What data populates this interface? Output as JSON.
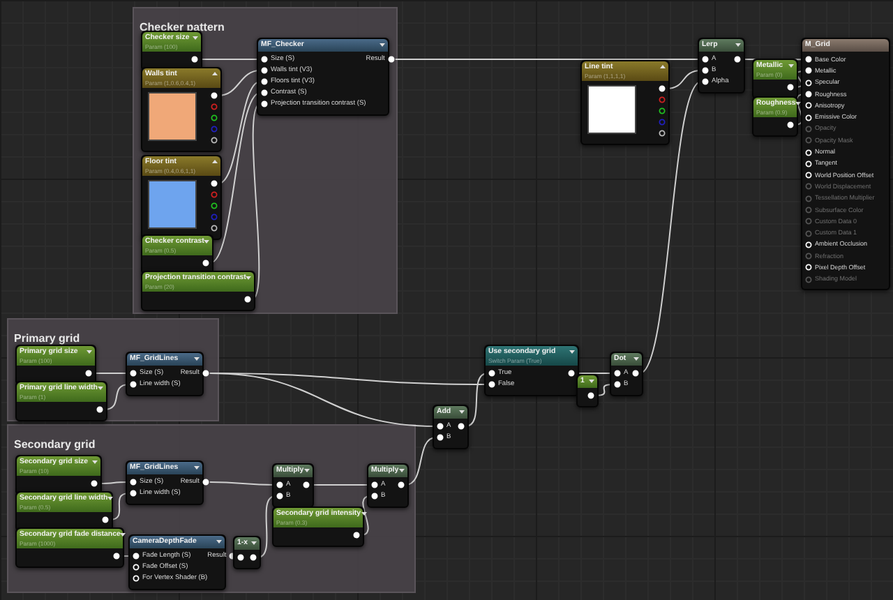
{
  "comments": [
    {
      "title": "Checker pattern"
    },
    {
      "title": "Primary grid"
    },
    {
      "title": "Secondary grid"
    }
  ],
  "nodes": [
    {
      "kind": "scalar_param",
      "title": "Checker size",
      "subtitle": "Param (100)",
      "outputs": [
        {
          "connected": true
        }
      ]
    },
    {
      "kind": "vector_param",
      "title": "Walls tint",
      "subtitle": "Param (1,0.6,0.4,1)",
      "color": "#f0a878",
      "outputs": [
        {
          "color": "#ffffff",
          "connected": true
        },
        {
          "color": "#d02020",
          "connected": false
        },
        {
          "color": "#20c020",
          "connected": false
        },
        {
          "color": "#2020c0",
          "connected": false
        },
        {
          "color": "#bbbbbb",
          "connected": false
        }
      ]
    },
    {
      "kind": "vector_param",
      "title": "Floor tint",
      "subtitle": "Param (0.4,0.6,1,1)",
      "color": "#6ea4ee",
      "outputs": [
        {
          "color": "#ffffff",
          "connected": true
        },
        {
          "color": "#d02020",
          "connected": false
        },
        {
          "color": "#20c020",
          "connected": false
        },
        {
          "color": "#2020c0",
          "connected": false
        },
        {
          "color": "#bbbbbb",
          "connected": false
        }
      ]
    },
    {
      "kind": "scalar_param",
      "title": "Checker contrast",
      "subtitle": "Param (0.5)",
      "outputs": [
        {
          "connected": true
        }
      ]
    },
    {
      "kind": "scalar_param",
      "title": "Projection transition contrast",
      "subtitle": "Param (20)",
      "outputs": [
        {
          "connected": true
        }
      ]
    },
    {
      "kind": "function",
      "title": "MF_Checker",
      "inputs": [
        {
          "label": "Size (S)",
          "connected": true
        },
        {
          "label": "Walls tint (V3)",
          "connected": true
        },
        {
          "label": "Floors tint (V3)",
          "connected": true
        },
        {
          "label": "Contrast (S)",
          "connected": true
        },
        {
          "label": "Projection transition contrast (S)",
          "connected": true
        }
      ],
      "outputs": [
        {
          "label": "Result",
          "connected": true
        }
      ]
    },
    {
      "kind": "vector_param",
      "title": "Line tint",
      "subtitle": "Param (1,1,1,1)",
      "color": "#ffffff",
      "outputs": [
        {
          "color": "#ffffff",
          "connected": true
        },
        {
          "color": "#d02020",
          "connected": false
        },
        {
          "color": "#20c020",
          "connected": false
        },
        {
          "color": "#2020c0",
          "connected": false
        },
        {
          "color": "#bbbbbb",
          "connected": false
        }
      ]
    },
    {
      "kind": "math",
      "title": "Lerp",
      "inputs": [
        {
          "label": "A",
          "connected": true
        },
        {
          "label": "B",
          "connected": true
        },
        {
          "label": "Alpha",
          "connected": true
        }
      ],
      "outputs": [
        {
          "connected": true
        }
      ]
    },
    {
      "kind": "scalar_param",
      "title": "Metallic",
      "subtitle": "Param (0)",
      "outputs": [
        {
          "connected": true
        }
      ]
    },
    {
      "kind": "scalar_param",
      "title": "Roughness",
      "subtitle": "Param (0.9)",
      "outputs": [
        {
          "connected": true
        }
      ]
    },
    {
      "kind": "result",
      "title": "M_Grid",
      "inputs": [
        {
          "label": "Base Color",
          "connected": true,
          "disabled": false
        },
        {
          "label": "Metallic",
          "connected": true,
          "disabled": false
        },
        {
          "label": "Specular",
          "connected": false,
          "disabled": false
        },
        {
          "label": "Roughness",
          "connected": true,
          "disabled": false
        },
        {
          "label": "Anisotropy",
          "connected": false,
          "disabled": false
        },
        {
          "label": "Emissive Color",
          "connected": false,
          "disabled": false
        },
        {
          "label": "Opacity",
          "connected": false,
          "disabled": true
        },
        {
          "label": "Opacity Mask",
          "connected": false,
          "disabled": true
        },
        {
          "label": "Normal",
          "connected": false,
          "disabled": false
        },
        {
          "label": "Tangent",
          "connected": false,
          "disabled": false
        },
        {
          "label": "World Position Offset",
          "connected": false,
          "disabled": false
        },
        {
          "label": "World Displacement",
          "connected": false,
          "disabled": true
        },
        {
          "label": "Tessellation Multiplier",
          "connected": false,
          "disabled": true
        },
        {
          "label": "Subsurface Color",
          "connected": false,
          "disabled": true
        },
        {
          "label": "Custom Data 0",
          "connected": false,
          "disabled": true
        },
        {
          "label": "Custom Data 1",
          "connected": false,
          "disabled": true
        },
        {
          "label": "Ambient Occlusion",
          "connected": false,
          "disabled": false
        },
        {
          "label": "Refraction",
          "connected": false,
          "disabled": true
        },
        {
          "label": "Pixel Depth Offset",
          "connected": false,
          "disabled": false
        },
        {
          "label": "Shading Model",
          "connected": false,
          "disabled": true
        }
      ]
    },
    {
      "kind": "scalar_param",
      "title": "Primary grid size",
      "subtitle": "Param (100)",
      "outputs": [
        {
          "connected": true
        }
      ]
    },
    {
      "kind": "scalar_param",
      "title": "Primary grid line width",
      "subtitle": "Param (1)",
      "outputs": [
        {
          "connected": true
        }
      ]
    },
    {
      "kind": "function",
      "title": "MF_GridLines",
      "inputs": [
        {
          "label": "Size (S)",
          "connected": true
        },
        {
          "label": "Line width (S)",
          "connected": true
        }
      ],
      "outputs": [
        {
          "label": "Result",
          "connected": true
        }
      ]
    },
    {
      "kind": "switch",
      "title": "Use secondary grid",
      "subtitle": "Switch Param (True)",
      "inputs": [
        {
          "label": "True",
          "connected": true
        },
        {
          "label": "False",
          "connected": true
        }
      ],
      "outputs": [
        {
          "connected": true
        }
      ]
    },
    {
      "kind": "constant",
      "title": "1",
      "outputs": [
        {
          "connected": true
        }
      ]
    },
    {
      "kind": "math",
      "title": "Dot",
      "inputs": [
        {
          "label": "A",
          "connected": true
        },
        {
          "label": "B",
          "connected": true
        }
      ],
      "outputs": [
        {
          "connected": true
        }
      ]
    },
    {
      "kind": "math",
      "title": "Add",
      "inputs": [
        {
          "label": "A",
          "connected": true
        },
        {
          "label": "B",
          "connected": true
        }
      ],
      "outputs": [
        {
          "connected": true
        }
      ]
    },
    {
      "kind": "scalar_param",
      "title": "Secondary grid size",
      "subtitle": "Param (10)",
      "outputs": [
        {
          "connected": true
        }
      ]
    },
    {
      "kind": "scalar_param",
      "title": "Secondary grid line width",
      "subtitle": "Param (0.5)",
      "outputs": [
        {
          "connected": true
        }
      ]
    },
    {
      "kind": "scalar_param",
      "title": "Secondary grid fade distance",
      "subtitle": "Param (1000)",
      "outputs": [
        {
          "connected": true
        }
      ]
    },
    {
      "kind": "function",
      "title": "MF_GridLines",
      "inputs": [
        {
          "label": "Size (S)",
          "connected": true
        },
        {
          "label": "Line width (S)",
          "connected": true
        }
      ],
      "outputs": [
        {
          "label": "Result",
          "connected": true
        }
      ]
    },
    {
      "kind": "function",
      "title": "CameraDepthFade",
      "inputs": [
        {
          "label": "Fade Length (S)",
          "connected": true
        },
        {
          "label": "Fade Offset (S)",
          "connected": false
        },
        {
          "label": "For Vertex Shader (B)",
          "connected": false
        }
      ],
      "outputs": [
        {
          "label": "Result",
          "connected": true
        }
      ]
    },
    {
      "kind": "math",
      "title": "1-x",
      "inputs": [
        {
          "connected": true
        }
      ],
      "outputs": [
        {
          "connected": true
        }
      ]
    },
    {
      "kind": "math",
      "title": "Multiply",
      "inputs": [
        {
          "label": "A",
          "connected": true
        },
        {
          "label": "B",
          "connected": true
        }
      ],
      "outputs": [
        {
          "connected": true
        }
      ]
    },
    {
      "kind": "scalar_param",
      "title": "Secondary grid intensity",
      "subtitle": "Param (0.3)",
      "outputs": [
        {
          "connected": true
        }
      ]
    },
    {
      "kind": "math",
      "title": "Multiply",
      "inputs": [
        {
          "label": "A",
          "connected": true
        },
        {
          "label": "B",
          "connected": true
        }
      ],
      "outputs": [
        {
          "connected": true
        }
      ]
    }
  ]
}
